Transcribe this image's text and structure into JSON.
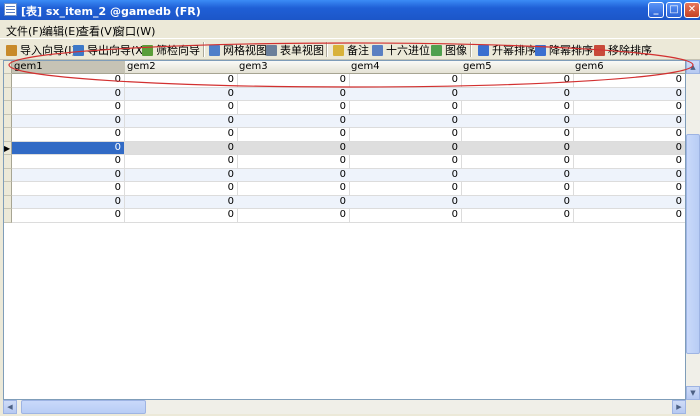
{
  "window": {
    "title": "[表] sx_item_2 @gamedb (FR)"
  },
  "menu": [
    "文件(F)",
    "编辑(E)",
    "查看(V)",
    "窗口(W)"
  ],
  "toolbar": [
    {
      "label": "导入向导(I)",
      "icon": "import-icon",
      "color": "#c88a2a"
    },
    {
      "label": "导出向导(X)",
      "icon": "export-icon",
      "color": "#3c78c8"
    },
    {
      "label": "筛检向导",
      "icon": "filter-icon",
      "color": "#5a9e3a"
    },
    {
      "label": "网格视图",
      "icon": "grid-view-icon",
      "color": "#4f7fc9"
    },
    {
      "label": "表单视图",
      "icon": "form-view-icon",
      "color": "#6b7f9a"
    },
    {
      "label": "备注",
      "icon": "memo-icon",
      "color": "#d8b23a"
    },
    {
      "label": "十六进位",
      "icon": "hex-icon",
      "color": "#5a7fc2"
    },
    {
      "label": "图像",
      "icon": "image-icon",
      "color": "#4fa04f"
    },
    {
      "label": "升幂排序",
      "icon": "sort-asc-icon",
      "color": "#3a6fd0"
    },
    {
      "label": "降幂排序",
      "icon": "sort-desc-icon",
      "color": "#3a6fd0"
    },
    {
      "label": "移除排序",
      "icon": "remove-sort-icon",
      "color": "#c84a3a"
    }
  ],
  "grid": {
    "columns": [
      "gem1",
      "gem2",
      "gem3",
      "gem4",
      "gem5",
      "gem6"
    ],
    "rows": [
      [
        "0",
        "0",
        "0",
        "0",
        "0",
        "0"
      ],
      [
        "0",
        "0",
        "0",
        "0",
        "0",
        "0"
      ],
      [
        "0",
        "0",
        "0",
        "0",
        "0",
        "0"
      ],
      [
        "0",
        "0",
        "0",
        "0",
        "0",
        "0"
      ],
      [
        "0",
        "0",
        "0",
        "0",
        "0",
        "0"
      ],
      [
        "0",
        "0",
        "0",
        "0",
        "0",
        "0"
      ],
      [
        "0",
        "0",
        "0",
        "0",
        "0",
        "0"
      ],
      [
        "0",
        "0",
        "0",
        "0",
        "0",
        "0"
      ],
      [
        "0",
        "0",
        "0",
        "0",
        "0",
        "0"
      ],
      [
        "0",
        "0",
        "0",
        "0",
        "0",
        "0"
      ],
      [
        "0",
        "0",
        "0",
        "0",
        "0",
        "0"
      ]
    ],
    "current_row": 5,
    "annotation_color": "#d23030"
  }
}
